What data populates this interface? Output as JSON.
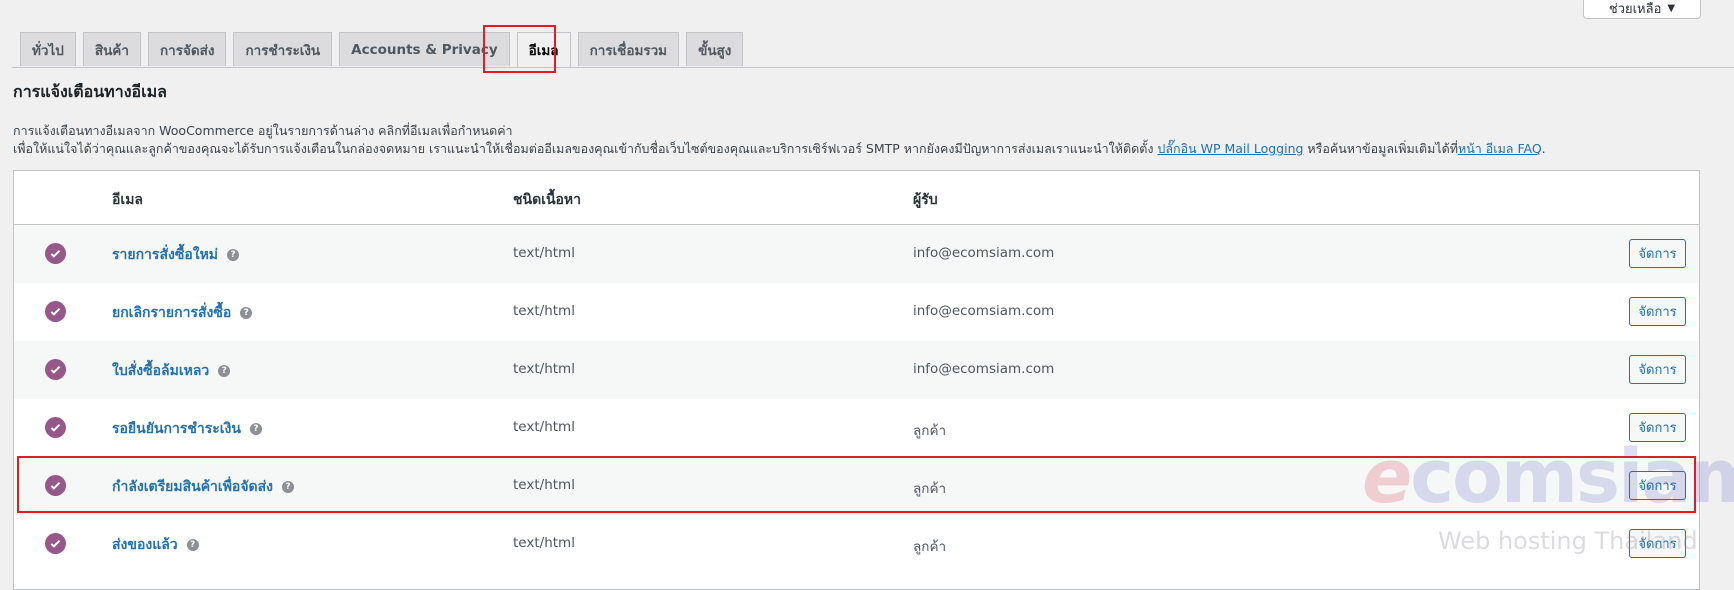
{
  "help": {
    "label": "ช่วยเหลือ",
    "arrow": "▼"
  },
  "tabs": [
    {
      "label": "ทั่วไป"
    },
    {
      "label": "สินค้า"
    },
    {
      "label": "การจัดส่ง"
    },
    {
      "label": "การชำระเงิน"
    },
    {
      "label": "Accounts & Privacy"
    },
    {
      "label": "อีเมล"
    },
    {
      "label": "การเชื่อมรวม"
    },
    {
      "label": "ขั้นสูง"
    }
  ],
  "page": {
    "title": "การแจ้งเตือนทางอีเมล",
    "desc1": "การแจ้งเตือนทางอีเมลจาก WooCommerce อยู่ในรายการด้านล่าง คลิกที่อีเมลเพื่อกำหนดค่า",
    "desc2_a": "เพื่อให้แน่ใจได้ว่าคุณและลูกค้าของคุณจะได้รับการแจ้งเตือนในกล่องจดหมาย เราแนะนำให้เชื่อมต่ออีเมลของคุณเข้ากับชื่อเว็บไซต์ของคุณและบริการเซิร์ฟเวอร์ SMTP หากยังคงมีปัญหาการส่งเมลเราแนะนำให้ติดตั้ง ",
    "desc2_link1": "ปลั๊กอิน WP Mail Logging",
    "desc2_b": " หรือค้นหาข้อมูลเพิ่มเติมได้ที่",
    "desc2_link2": "หน้า อีเมล FAQ",
    "desc2_c": "."
  },
  "table": {
    "headers": {
      "email": "อีเมล",
      "content_type": "ชนิดเนื้อหา",
      "recipient": "ผู้รับ"
    },
    "rows": [
      {
        "name": "รายการสั่งซื้อใหม่",
        "type": "text/html",
        "recipient": "info@ecomsiam.com",
        "action": "จัดการ"
      },
      {
        "name": "ยกเลิกรายการสั่งซื้อ",
        "type": "text/html",
        "recipient": "info@ecomsiam.com",
        "action": "จัดการ"
      },
      {
        "name": "ใบสั่งซื้อล้มเหลว",
        "type": "text/html",
        "recipient": "info@ecomsiam.com",
        "action": "จัดการ"
      },
      {
        "name": "รอยืนยันการชำระเงิน",
        "type": "text/html",
        "recipient": "ลูกค้า",
        "action": "จัดการ"
      },
      {
        "name": "กำลังเตรียมสินค้าเพื่อจัดส่ง",
        "type": "text/html",
        "recipient": "ลูกค้า",
        "action": "จัดการ"
      },
      {
        "name": "ส่งของแล้ว",
        "type": "text/html",
        "recipient": "ลูกค้า",
        "action": "จัดการ"
      }
    ]
  },
  "watermark": {
    "logo_e": "e",
    "logo_rest": "comsiam",
    "tagline": "Web hosting Thailand"
  },
  "colors": {
    "accent": "#2271b1",
    "check": "#96588a",
    "highlight": "#e31b23"
  }
}
